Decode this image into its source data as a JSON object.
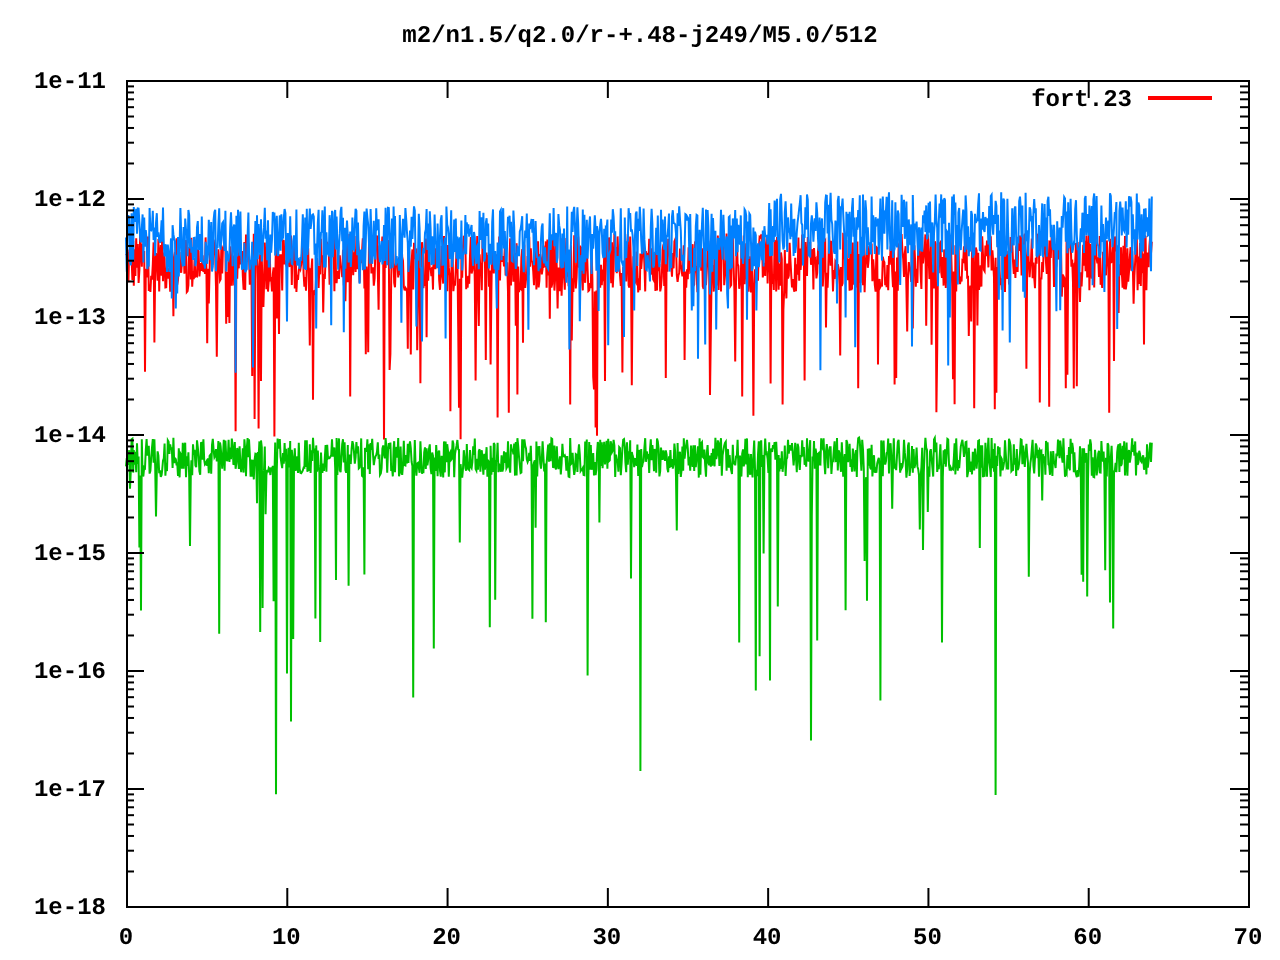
{
  "title": "m2/n1.5/q2.0/r-+.48-j249/M5.0/512",
  "y_ticks": [
    "1e-11",
    "1e-12",
    "1e-13",
    "1e-14",
    "1e-15",
    "1e-16",
    "1e-17",
    "1e-18"
  ],
  "x_ticks": [
    "0",
    "10",
    "20",
    "30",
    "40",
    "50",
    "60",
    "70"
  ],
  "legend": {
    "label": "fort.23",
    "color": "#ff0000"
  },
  "traces": [
    {
      "color": "#ff0000"
    },
    {
      "color": "#0080ff"
    },
    {
      "color": "#00c000"
    }
  ]
}
